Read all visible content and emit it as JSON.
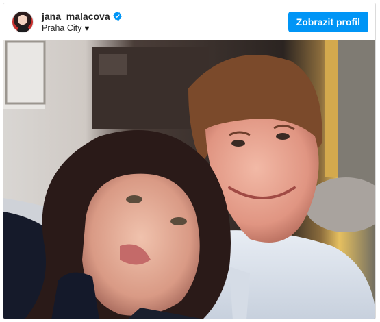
{
  "post": {
    "username": "jana_malacova",
    "verified": true,
    "location": "Praha City",
    "location_suffix": "♥",
    "profile_button_label": "Zobrazit profil"
  },
  "icons": {
    "avatar": "profile-avatar",
    "verified": "verified-badge-icon",
    "heart": "heart-icon"
  },
  "colors": {
    "button_bg": "#0095f6",
    "verified_badge": "#0095f6",
    "text": "#262626"
  }
}
